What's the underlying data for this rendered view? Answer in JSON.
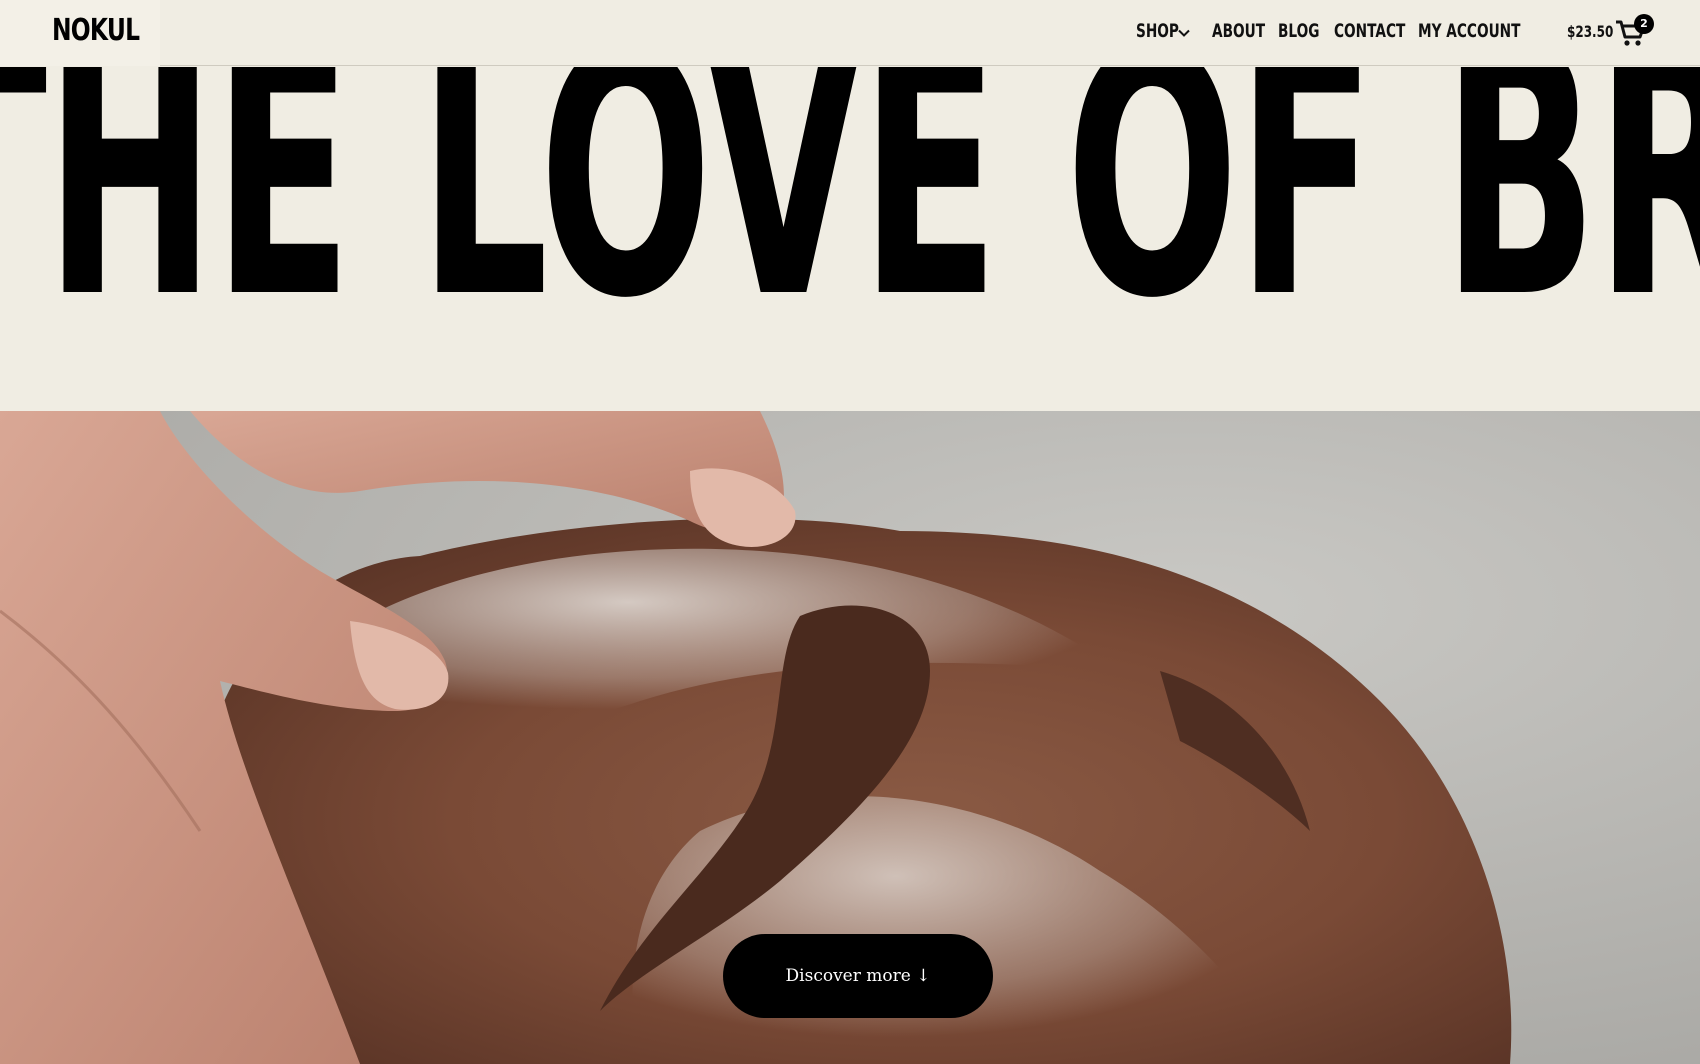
{
  "brand": {
    "name": "NOKUL"
  },
  "nav": {
    "shop": "SHOP",
    "about": "ABOUT",
    "blog": "BLOG",
    "contact": "CONTACT",
    "account": "MY ACCOUNT"
  },
  "cart": {
    "total": "$23.50",
    "count": "2",
    "icon": "shopping-cart-icon"
  },
  "hero": {
    "title": "THE LOVE OF BREAD",
    "image": "hands-holding-sourdough-loaf"
  },
  "cta": {
    "label": "Discover more ↓"
  },
  "colors": {
    "background": "#f0ede3",
    "text": "#000000",
    "button": "#000000"
  }
}
